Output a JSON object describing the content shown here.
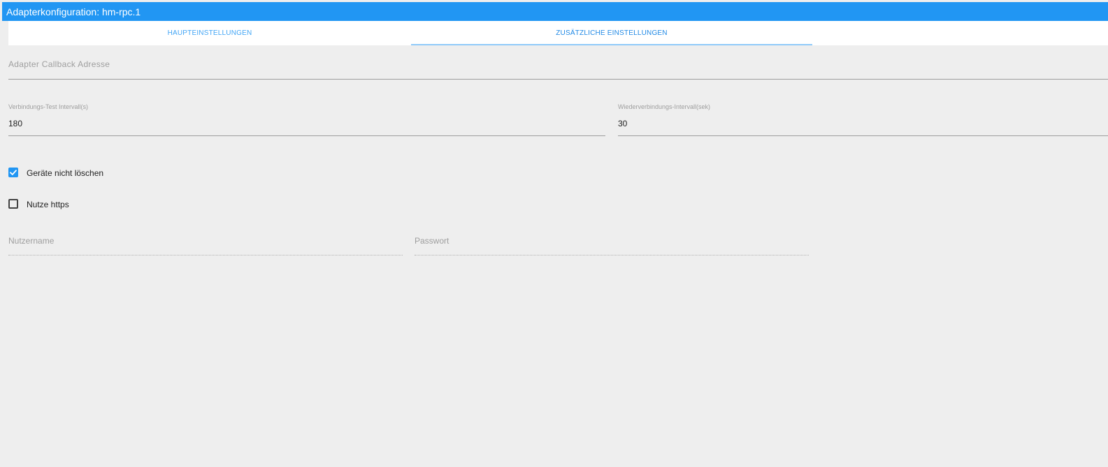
{
  "window": {
    "title": "Adapterkonfiguration: hm-rpc.1"
  },
  "tabs": [
    {
      "label": "HAUPTEINSTELLUNGEN",
      "active": false
    },
    {
      "label": "ZUSÄTZLICHE EINSTELLUNGEN",
      "active": true
    }
  ],
  "fields": {
    "callback_address": {
      "placeholder": "Adapter Callback Adresse",
      "value": ""
    },
    "connection_test_interval": {
      "label": "Verbindungs-Test Intervall(s)",
      "value": "180"
    },
    "reconnect_interval": {
      "label": "Wiederverbindungs-Intervall(sek)",
      "value": "30"
    },
    "username": {
      "placeholder": "Nutzername",
      "value": ""
    },
    "password": {
      "placeholder": "Passwort",
      "value": ""
    }
  },
  "checkboxes": {
    "dont_delete_devices": {
      "label": "Geräte nicht löschen",
      "checked": true
    },
    "use_https": {
      "label": "Nutze https",
      "checked": false
    }
  },
  "colors": {
    "accent": "#2196f3",
    "background": "#eeeeee",
    "label": "#9e9e9e"
  }
}
